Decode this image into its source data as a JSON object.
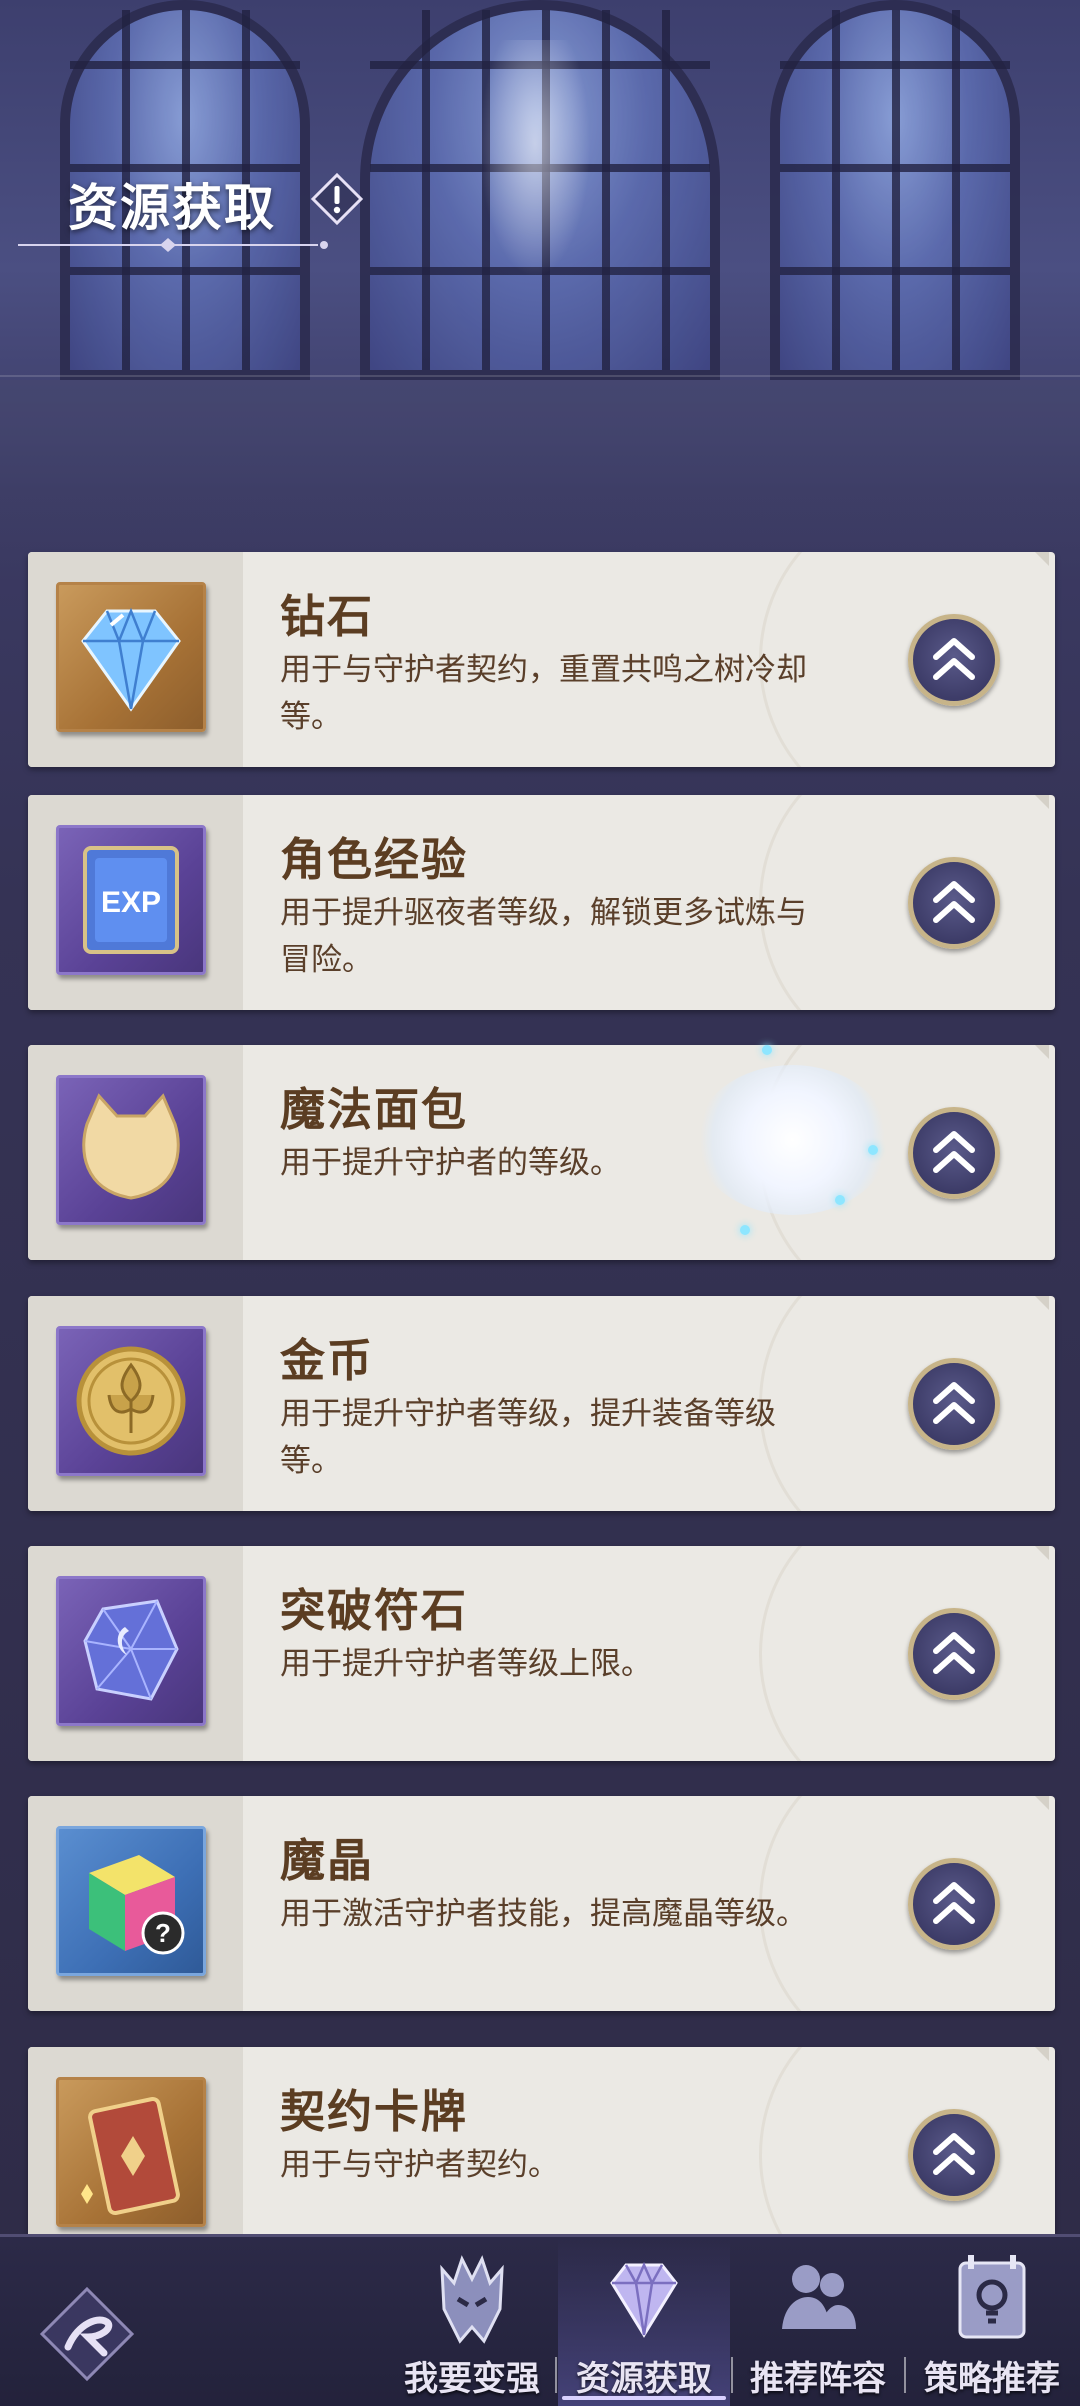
{
  "header": {
    "title": "资源获取",
    "info_icon": "warning-diamond-icon"
  },
  "resources": [
    {
      "name": "钻石",
      "desc": "用于与守护者契约，重置共鸣之树冷却等。",
      "icon": "diamond-icon",
      "frame": "gold"
    },
    {
      "name": "角色经验",
      "desc": "用于提升驱夜者等级，解锁更多试炼与冒险。",
      "icon": "exp-book-icon",
      "frame": "purple"
    },
    {
      "name": "魔法面包",
      "desc": "用于提升守护者的等级。",
      "icon": "cat-bread-icon",
      "frame": "purple"
    },
    {
      "name": "金币",
      "desc": "用于提升守护者等级，提升装备等级等。",
      "icon": "gold-coin-icon",
      "frame": "purple"
    },
    {
      "name": "突破符石",
      "desc": "用于提升守护者等级上限。",
      "icon": "rune-crystal-icon",
      "frame": "purple"
    },
    {
      "name": "魔晶",
      "desc": "用于激活守护者技能，提高魔晶等级。",
      "icon": "rainbow-cube-icon",
      "frame": "blue"
    },
    {
      "name": "契约卡牌",
      "desc": "用于与守护者契约。",
      "icon": "contract-card-icon",
      "frame": "gold"
    }
  ],
  "go_button_icon": "double-chevron-up-icon",
  "bottom_nav": {
    "logo_icon": "game-logo-icon",
    "tabs": [
      {
        "label": "我要变强",
        "icon": "helmet-icon",
        "active": false
      },
      {
        "label": "资源获取",
        "icon": "diamond-icon",
        "active": true
      },
      {
        "label": "推荐阵容",
        "icon": "team-icon",
        "active": false
      },
      {
        "label": "策略推荐",
        "icon": "strategy-book-icon",
        "active": false
      }
    ]
  },
  "colors": {
    "card_bg": "#ebe9e4",
    "title_brown": "#5b3d22",
    "button_navy": "#3d3c68",
    "nav_bg": "#2c2a48"
  }
}
